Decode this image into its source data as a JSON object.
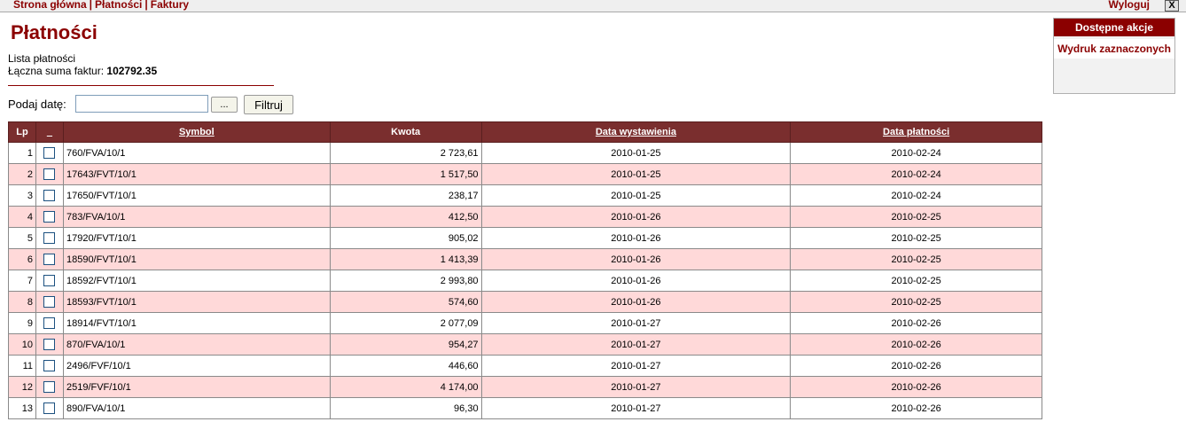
{
  "nav": {
    "items": [
      "Strona główna",
      "Płatności",
      "Faktury"
    ],
    "logout_label": "Wyloguj",
    "close_label": "X"
  },
  "page": {
    "title": "Płatności",
    "list_label": "Lista płatności",
    "total_label": "Łączna suma faktur:",
    "total_value": "102792.35"
  },
  "filter": {
    "label": "Podaj datę:",
    "date_value": "",
    "picker_label": "...",
    "submit_label": "Filtruj"
  },
  "table": {
    "columns": [
      "Lp",
      "_",
      "Symbol",
      "Kwota",
      "Data wystawienia",
      "Data płatności"
    ],
    "rows": [
      {
        "lp": "1",
        "symbol": "760/FVA/10/1",
        "kwota": "2 723,61",
        "data_wyst": "2010-01-25",
        "data_plat": "2010-02-24"
      },
      {
        "lp": "2",
        "symbol": "17643/FVT/10/1",
        "kwota": "1 517,50",
        "data_wyst": "2010-01-25",
        "data_plat": "2010-02-24"
      },
      {
        "lp": "3",
        "symbol": "17650/FVT/10/1",
        "kwota": "238,17",
        "data_wyst": "2010-01-25",
        "data_plat": "2010-02-24"
      },
      {
        "lp": "4",
        "symbol": "783/FVA/10/1",
        "kwota": "412,50",
        "data_wyst": "2010-01-26",
        "data_plat": "2010-02-25"
      },
      {
        "lp": "5",
        "symbol": "17920/FVT/10/1",
        "kwota": "905,02",
        "data_wyst": "2010-01-26",
        "data_plat": "2010-02-25"
      },
      {
        "lp": "6",
        "symbol": "18590/FVT/10/1",
        "kwota": "1 413,39",
        "data_wyst": "2010-01-26",
        "data_plat": "2010-02-25"
      },
      {
        "lp": "7",
        "symbol": "18592/FVT/10/1",
        "kwota": "2 993,80",
        "data_wyst": "2010-01-26",
        "data_plat": "2010-02-25"
      },
      {
        "lp": "8",
        "symbol": "18593/FVT/10/1",
        "kwota": "574,60",
        "data_wyst": "2010-01-26",
        "data_plat": "2010-02-25"
      },
      {
        "lp": "9",
        "symbol": "18914/FVT/10/1",
        "kwota": "2 077,09",
        "data_wyst": "2010-01-27",
        "data_plat": "2010-02-26"
      },
      {
        "lp": "10",
        "symbol": "870/FVA/10/1",
        "kwota": "954,27",
        "data_wyst": "2010-01-27",
        "data_plat": "2010-02-26"
      },
      {
        "lp": "11",
        "symbol": "2496/FVF/10/1",
        "kwota": "446,60",
        "data_wyst": "2010-01-27",
        "data_plat": "2010-02-26"
      },
      {
        "lp": "12",
        "symbol": "2519/FVF/10/1",
        "kwota": "4 174,00",
        "data_wyst": "2010-01-27",
        "data_plat": "2010-02-26"
      },
      {
        "lp": "13",
        "symbol": "890/FVA/10/1",
        "kwota": "96,30",
        "data_wyst": "2010-01-27",
        "data_plat": "2010-02-26"
      }
    ]
  },
  "actions": {
    "title": "Dostępne akcje",
    "print_label": "Wydruk zaznaczonych"
  }
}
